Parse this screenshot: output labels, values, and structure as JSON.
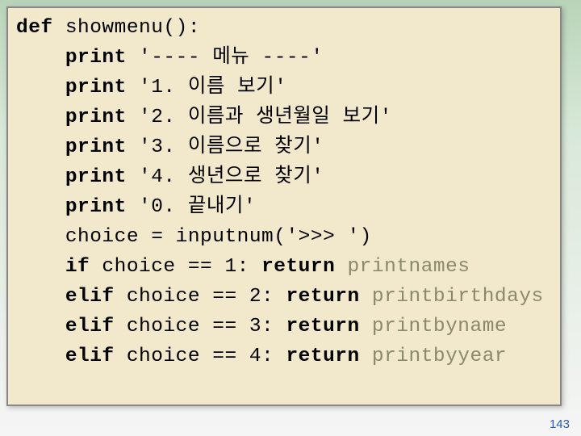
{
  "code_lines": [
    {
      "indent": 0,
      "segments": [
        {
          "t": "def ",
          "c": "kw"
        },
        {
          "t": "showmenu():",
          "c": ""
        }
      ]
    },
    {
      "indent": 1,
      "segments": [
        {
          "t": "print",
          "c": "kw"
        },
        {
          "t": " '---- 메뉴 ----'",
          "c": "str"
        }
      ]
    },
    {
      "indent": 1,
      "segments": [
        {
          "t": "print",
          "c": "kw"
        },
        {
          "t": " '1. 이름 보기'",
          "c": "str"
        }
      ]
    },
    {
      "indent": 1,
      "segments": [
        {
          "t": "print",
          "c": "kw"
        },
        {
          "t": " '2. 이름과 생년월일 보기'",
          "c": "str"
        }
      ]
    },
    {
      "indent": 1,
      "segments": [
        {
          "t": "print",
          "c": "kw"
        },
        {
          "t": " '3. 이름으로 찾기'",
          "c": "str"
        }
      ]
    },
    {
      "indent": 1,
      "segments": [
        {
          "t": "print",
          "c": "kw"
        },
        {
          "t": " '4. 생년으로 찾기'",
          "c": "str"
        }
      ]
    },
    {
      "indent": 1,
      "segments": [
        {
          "t": "print",
          "c": "kw"
        },
        {
          "t": " '0. 끝내기'",
          "c": "str"
        }
      ]
    },
    {
      "indent": 1,
      "segments": [
        {
          "t": "choice = inputnum('>>> ')",
          "c": ""
        }
      ]
    },
    {
      "indent": 1,
      "segments": [
        {
          "t": "if",
          "c": "kw"
        },
        {
          "t": " choice == 1: ",
          "c": ""
        },
        {
          "t": "return",
          "c": "kw"
        },
        {
          "t": " ",
          "c": ""
        },
        {
          "t": "printnames",
          "c": "dim"
        }
      ]
    },
    {
      "indent": 1,
      "segments": [
        {
          "t": "elif",
          "c": "kw"
        },
        {
          "t": " choice == 2: ",
          "c": ""
        },
        {
          "t": "return",
          "c": "kw"
        },
        {
          "t": " ",
          "c": ""
        },
        {
          "t": "printbirthdays",
          "c": "dim"
        }
      ]
    },
    {
      "indent": 1,
      "segments": [
        {
          "t": "elif",
          "c": "kw"
        },
        {
          "t": " choice == 3: ",
          "c": ""
        },
        {
          "t": "return",
          "c": "kw"
        },
        {
          "t": " ",
          "c": ""
        },
        {
          "t": "printbyname",
          "c": "dim"
        }
      ]
    },
    {
      "indent": 1,
      "segments": [
        {
          "t": "elif",
          "c": "kw"
        },
        {
          "t": " choice == 4: ",
          "c": ""
        },
        {
          "t": "return",
          "c": "kw"
        },
        {
          "t": " ",
          "c": ""
        },
        {
          "t": "printbyyear",
          "c": "dim"
        }
      ]
    }
  ],
  "indent_unit": "    ",
  "page_number": "143"
}
